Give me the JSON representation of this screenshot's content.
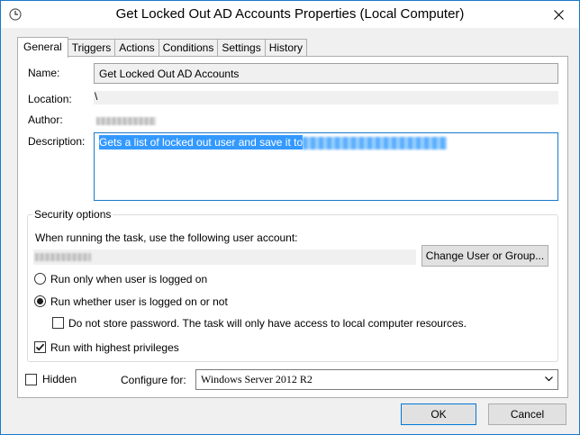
{
  "window": {
    "title": "Get Locked Out AD Accounts Properties (Local Computer)"
  },
  "tabs": [
    {
      "label": "General",
      "active": true
    },
    {
      "label": "Triggers",
      "active": false
    },
    {
      "label": "Actions",
      "active": false
    },
    {
      "label": "Conditions",
      "active": false
    },
    {
      "label": "Settings",
      "active": false
    },
    {
      "label": "History",
      "active": false
    }
  ],
  "general": {
    "name_label": "Name:",
    "name_value": "Get Locked Out AD Accounts",
    "location_label": "Location:",
    "location_value": "\\",
    "author_label": "Author:",
    "description_label": "Description:",
    "description_value": "Gets a list of locked out user and save it to"
  },
  "security": {
    "title": "Security options",
    "run_as_label": "When running the task, use the following user account:",
    "change_user_button": "Change User or Group...",
    "radio_logged_on": "Run only when user is logged on",
    "radio_logged_on_checked": false,
    "radio_whether": "Run whether user is logged on or not",
    "radio_whether_checked": true,
    "no_store_password": "Do not store password.  The task will only have access to local computer resources.",
    "no_store_password_checked": false,
    "highest_privileges": "Run with highest privileges",
    "highest_privileges_checked": true
  },
  "bottom": {
    "hidden_label": "Hidden",
    "hidden_checked": false,
    "configure_for_label": "Configure for:",
    "configure_for_value": "Windows Server 2012 R2"
  },
  "buttons": {
    "ok": "OK",
    "cancel": "Cancel"
  },
  "colors": {
    "selection": "#3399ff",
    "window_border": "#1979ca"
  }
}
